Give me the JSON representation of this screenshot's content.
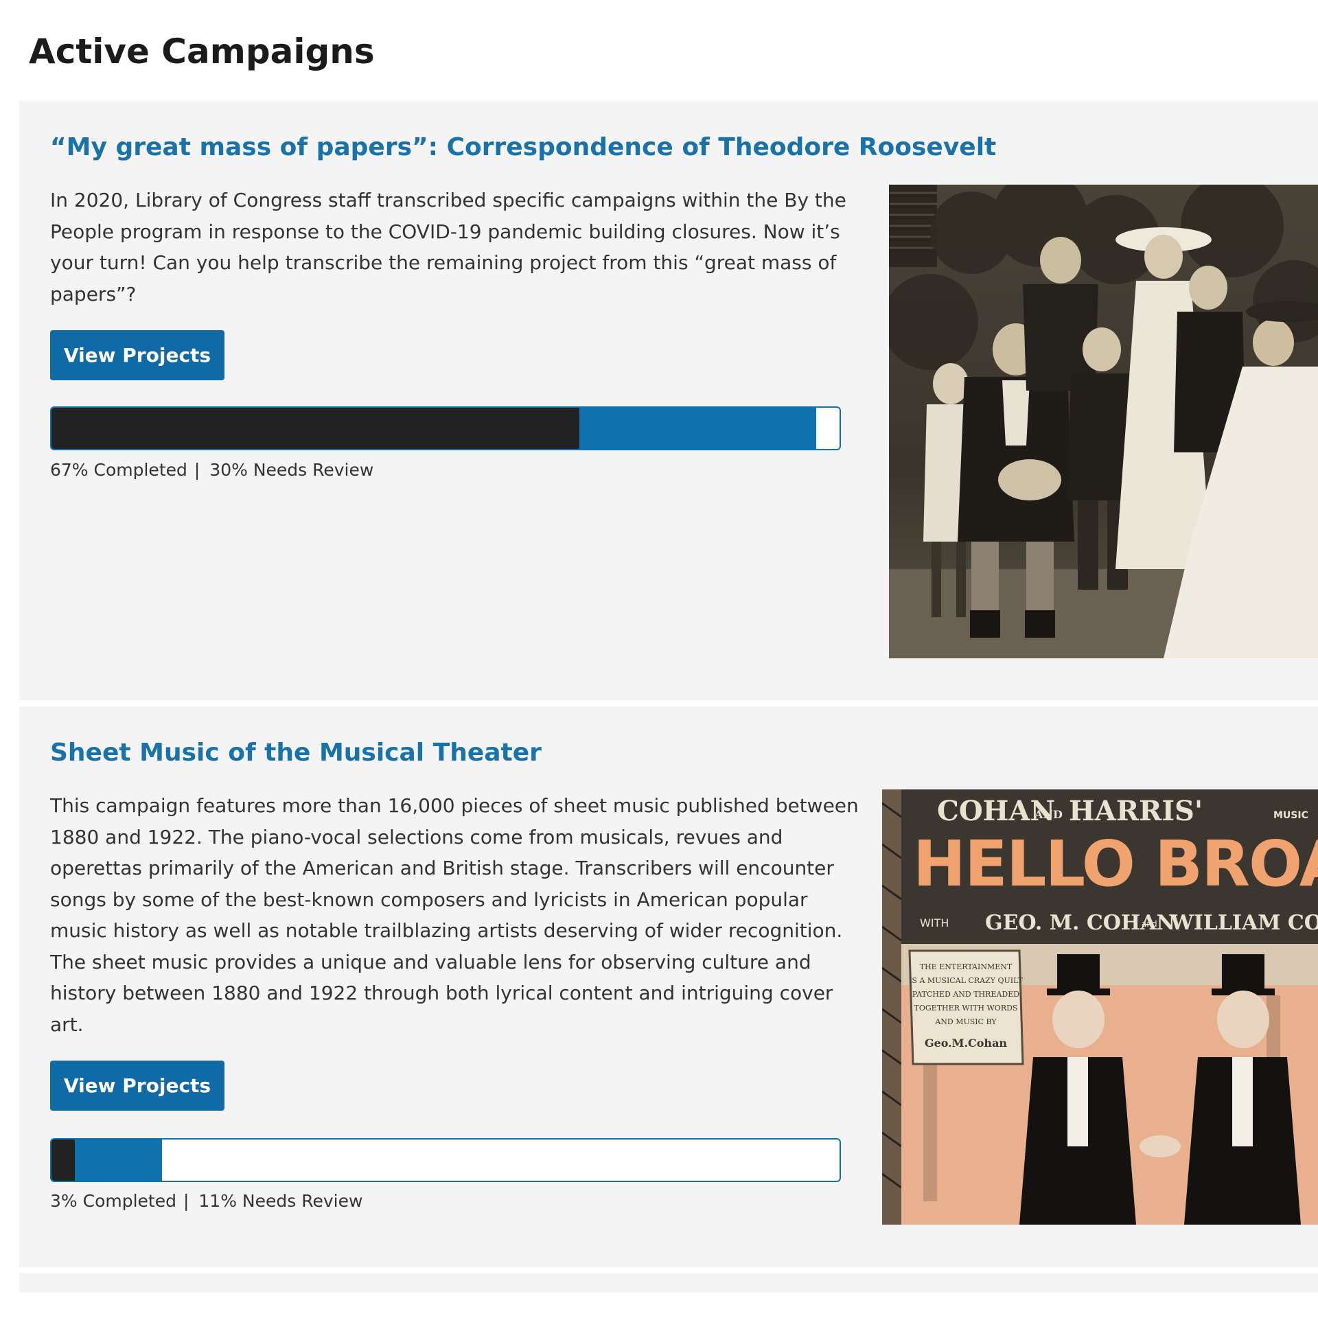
{
  "page": {
    "title": "Active Campaigns"
  },
  "colors": {
    "accent": "#0f72b0",
    "title_blue": "#1a73a8",
    "completed": "#222222",
    "panel_bg": "#f4f4f4"
  },
  "campaigns": [
    {
      "title": "“My great mass of papers”: Correspondence of Theodore Roosevelt",
      "description": "In 2020, Library of Congress staff transcribed specific campaigns within the By the People program in response to the COVID-19 pandemic building closures. Now it’s your turn! Can you help transcribe the remaining project from this “great mass of papers”?",
      "button_label": "View Projects",
      "completed_percent": 67,
      "needs_review_percent": 30,
      "completed_label": "67% Completed",
      "separator": "|",
      "review_label": "30% Needs Review",
      "image": "roosevelt-family-photo"
    },
    {
      "title": "Sheet Music of the Musical Theater",
      "description": "This campaign features more than 16,000 pieces of sheet music published between 1880 and 1922. The piano-vocal selections come from musicals, revues and operettas primarily of the American and British stage. Transcribers will encounter songs by some of the best-known composers and lyricists in American popular music history as well as notable trailblazing artists deserving of wider recognition. The sheet music provides a unique and valuable lens for observing culture and history between 1880 and 1922 through both lyrical content and intriguing cover art.",
      "button_label": "View Projects",
      "completed_percent": 3,
      "needs_review_percent": 11,
      "completed_label": "3% Completed",
      "separator": "|",
      "review_label": "11% Needs Review",
      "image": "hello-broadway-sheet-music-cover",
      "cover_text": {
        "line1_left": "COHAN",
        "line1_and": "AND",
        "line1_right": "HARRIS'",
        "line1_music": "MUSIC",
        "headline": "HELLO BROADW",
        "credits_with": "WITH",
        "credits_cohan": "GEO. M. COHAN",
        "credits_and": "and",
        "credits_william": "WILLIAM CO",
        "scroll_line1": "THE ENTERTAINMENT",
        "scroll_line2": "IS A MUSICAL CRAZY QUILT",
        "scroll_line3": "PATCHED AND THREADED",
        "scroll_line4": "TOGETHER WITH WORDS",
        "scroll_line5": "AND MUSIC BY",
        "scroll_sig": "Geo.M.Cohan"
      }
    }
  ]
}
